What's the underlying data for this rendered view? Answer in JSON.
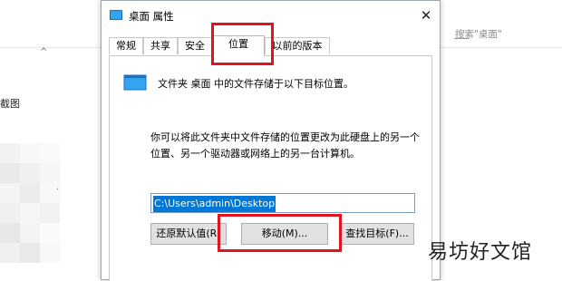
{
  "background": {
    "search_placeholder": "搜索\"桌面\"",
    "sidebar_label": "截图"
  },
  "dialog": {
    "title": "桌面 属性",
    "close_glyph": "✕",
    "tabs": [
      {
        "label": "常规"
      },
      {
        "label": "共享"
      },
      {
        "label": "安全"
      },
      {
        "label": "位置"
      },
      {
        "label": "以前的版本"
      }
    ],
    "active_tab": "位置",
    "info_text": "文件夹 桌面 中的文件存储于以下目标位置。",
    "description": "你可以将此文件夹中文件存储的位置更改为此硬盘上的另一个位置、另一个驱动器或网络上的另一台计算机。",
    "path_value": "C:\\Users\\admin\\Desktop",
    "buttons": {
      "restore": "还原默认值(R)",
      "move": "移动(M)...",
      "find_target": "查找目标(F)..."
    }
  },
  "watermark": "易坊好文馆",
  "colors": {
    "highlight": "#e0141e",
    "selection": "#0078d7",
    "folder_icon": "#34a3f0"
  }
}
